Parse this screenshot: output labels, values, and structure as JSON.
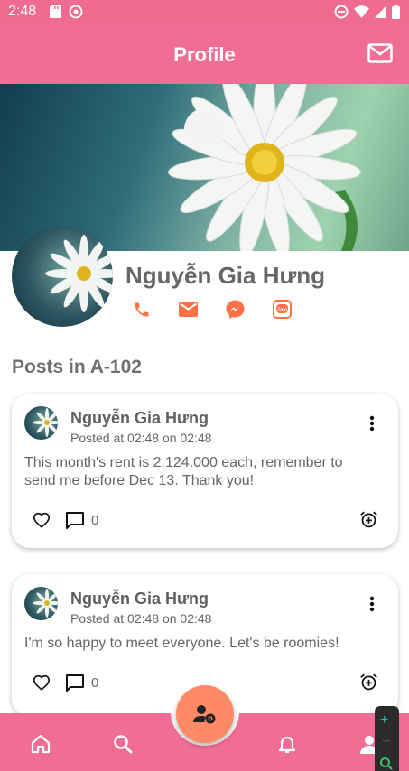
{
  "status_bar": {
    "time": "2:48"
  },
  "app_bar": {
    "title": "Profile",
    "mail_icon": "mail-icon"
  },
  "profile": {
    "name": "Nguyễn Gia Hưng",
    "contacts": [
      "phone-icon",
      "email-icon",
      "messenger-icon",
      "zalo-icon"
    ],
    "zalo_label": "Zalo"
  },
  "section_title": "Posts in A-102",
  "posts": [
    {
      "author": "Nguyễn Gia Hưng",
      "time": "Posted at 02:48 on 02:48",
      "body": "This month's rent is 2.124.000 each, remember to send me before Dec 13. Thank you!",
      "comments": "0"
    },
    {
      "author": "Nguyễn Gia Hưng",
      "time": "Posted at 02:48 on 02:48",
      "body": "I'm so happy to meet everyone. Let's be roomies!",
      "comments": "0"
    }
  ],
  "bottom_nav": [
    "home-icon",
    "search-icon",
    "group-settings-icon",
    "bell-icon",
    "user-icon"
  ],
  "zoom": {
    "in": "+",
    "out": "−"
  },
  "colors": {
    "primary": "#f06e95",
    "fab": "#ff8a65",
    "contact_icons": "#ff7043"
  }
}
